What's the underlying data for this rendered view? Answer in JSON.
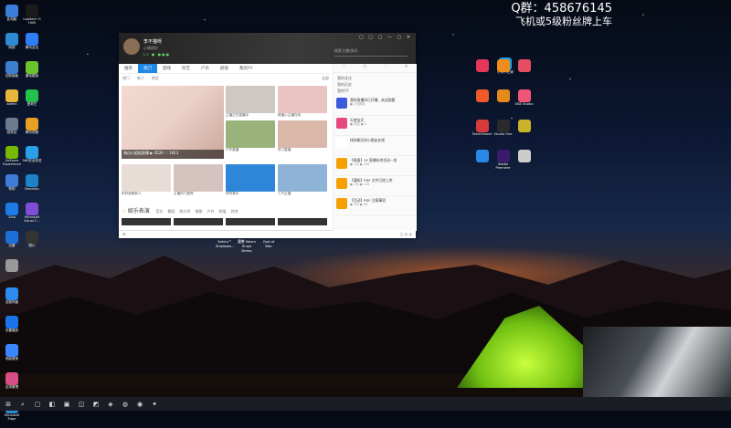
{
  "overlay": {
    "line1": "Q群：458676145",
    "line2": "飞机或5级粉丝牌上车"
  },
  "desktop_left": [
    {
      "label": "此电脑",
      "color": "#3b7dd8"
    },
    {
      "label": "网络",
      "color": "#2f8ad1"
    },
    {
      "label": "控制面板",
      "color": "#3d7fcf"
    },
    {
      "label": "admin",
      "color": "#e8b53a"
    },
    {
      "label": "回收站",
      "color": "#6b7c8f"
    },
    {
      "label": "GeForce Experience",
      "color": "#76b900"
    },
    {
      "label": "帮助",
      "color": "#3f7ad9"
    },
    {
      "label": "Zalo",
      "color": "#1e7be6"
    },
    {
      "label": "迅雷",
      "color": "#1c6fd6"
    },
    {
      "label": "",
      "color": "#999"
    },
    {
      "label": "百度网盘",
      "color": "#2d8cf0"
    },
    {
      "label": "迅雷播放",
      "color": "#1a73e8"
    },
    {
      "label": "电脑管家",
      "color": "#3a86ff"
    },
    {
      "label": "应用管理",
      "color": "#d84e84"
    },
    {
      "label": "Microsoft Edge",
      "color": "#2b8fd6"
    }
  ],
  "desktop_left2": [
    {
      "label": "Logitech G HUB",
      "color": "#1b1b1b"
    },
    {
      "label": "腾讯会议",
      "color": "#2f7ef5"
    },
    {
      "label": "雷电模拟",
      "color": "#6ac52d"
    },
    {
      "label": "爱奇艺",
      "color": "#25c24b"
    },
    {
      "label": "腾讯视频",
      "color": "#e7a021"
    },
    {
      "label": "360安全浏览",
      "color": "#2aa0e8"
    },
    {
      "label": "Bandizip",
      "color": "#1d82c6"
    },
    {
      "label": "Microsoft Visual C...",
      "color": "#7e4fd6"
    },
    {
      "label": "图片",
      "color": "#333"
    }
  ],
  "desktop_right": [
    {
      "label": "",
      "color": "#e6365b"
    },
    {
      "label": "",
      "color": "#f08c1c"
    },
    {
      "label": "",
      "color": "#e74d62"
    },
    {
      "label": "",
      "color": "#f05a28"
    },
    {
      "label": "",
      "color": "#e38a1a"
    },
    {
      "label": "OBS Studio",
      "color": "#f0567a"
    },
    {
      "label": "TeamViewer",
      "color": "#d63a3a"
    },
    {
      "label": "Studio One",
      "color": "#2a2a2a"
    },
    {
      "label": "",
      "color": "#c8b32a"
    },
    {
      "label": "",
      "color": "#2a88e8"
    },
    {
      "label": "Adobe Premiere",
      "color": "#3a1a6a"
    },
    {
      "label": "",
      "color": "#ccc"
    }
  ],
  "desktop_extra": {
    "label": "小刘不在家",
    "color": "#1aa0e0"
  },
  "window": {
    "username": "李不猫呀",
    "signature": "心情很好",
    "badges": "Lv ● ●●●",
    "controls": "▢ ▢ ▢ — ▢ ✕",
    "search_placeholder": "搜索主播/房间",
    "tabs": [
      "推荐",
      "热门",
      "游戏",
      "综艺",
      "户外",
      "颜值",
      "我的YY"
    ],
    "active_tab": 1,
    "subtabs": [
      "热门",
      "新人",
      "附近",
      "",
      "全部"
    ],
    "hero": {
      "caption": "海边小姐姐直播",
      "stats": "▶ 4526  ♡ 1923"
    },
    "cards": [
      {
        "title": "主播正在直播中",
        "color": "#cfc7c2"
      },
      {
        "title": "颜值小主播在线",
        "color": "#e9c4c2"
      },
      {
        "title": "户外直播",
        "color": "#9ab37a"
      },
      {
        "title": "热门直播",
        "color": "#d9b7a9"
      }
    ],
    "row2": [
      {
        "title": "你好我是新人",
        "color": "#e8dcd7"
      },
      {
        "title": "主播热门推荐",
        "color": "#d6c3bf"
      },
      {
        "title": "好听音乐",
        "color": "#2f86d8"
      },
      {
        "title": "人气主播",
        "color": "#8fb3d6"
      }
    ],
    "section_title": "娱乐表演",
    "section_subs": [
      "音乐",
      "舞蹈",
      "脱口秀",
      "唱歌",
      "户外",
      "颜值",
      "其他"
    ],
    "bottom_left": "☰",
    "bottom_right": "▢ ◎ ◎"
  },
  "right_panel": {
    "tabs": [
      "☆",
      "◷",
      "♡",
      "≡"
    ],
    "links": [
      "我的关注",
      "我的历史",
      "我的YY"
    ],
    "messages": [
      {
        "text": "我的直播间已开播，欢迎观看",
        "meta": "● 2分钟前",
        "color": "#3b5bdb"
      },
      {
        "text": "天使宝贝",
        "meta": "● 在线 ● 3",
        "color": "#e64980"
      },
      {
        "text": "找你聊天的小朋友在线",
        "meta": "",
        "color": "#fff"
      },
      {
        "text": "【周报】YY 直播年终活动一览",
        "meta": "● 1天  ● 256",
        "color": "#f59f00"
      },
      {
        "text": "【通知】PDF 文件已经上传",
        "meta": "● 2天  ● 128",
        "color": "#f59f00"
      },
      {
        "text": "【活动】PDF 注意事项",
        "meta": "● 3天  ● 96",
        "color": "#f59f00"
      }
    ]
  },
  "float_labels": [
    "Sekiro™ Shadows...",
    "魔兽 Warm Snow Demo",
    "God of War"
  ],
  "taskbar": [
    "⊞",
    "⌕",
    "▢",
    "◧",
    "▣",
    "◫",
    "◩",
    "◈",
    "◍",
    "◉",
    "✦"
  ]
}
